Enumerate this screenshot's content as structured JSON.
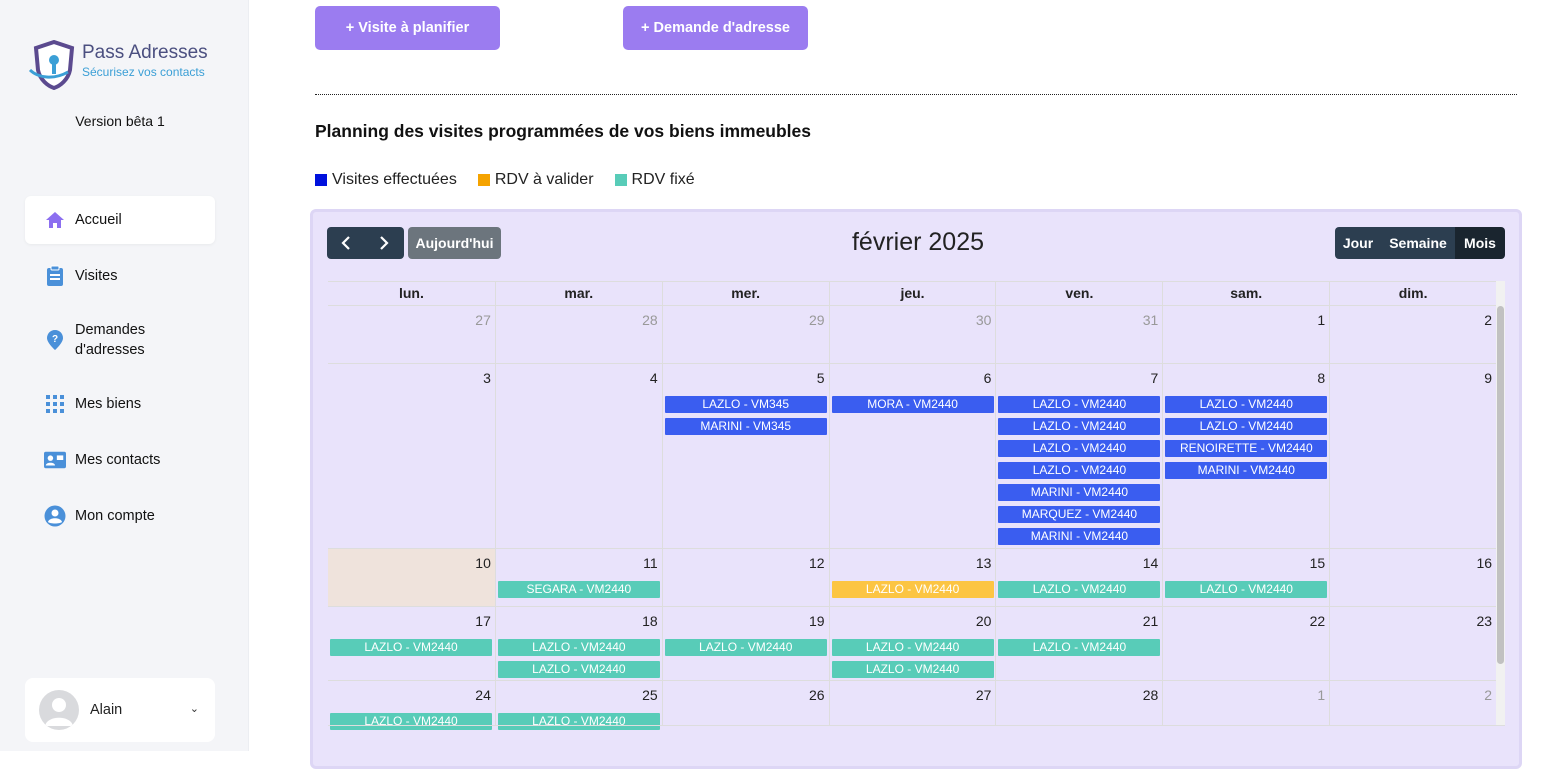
{
  "sidebar": {
    "logo_title": "Pass Adresses",
    "logo_tagline": "Sécurisez vos contacts",
    "version": "Version bêta 1",
    "items": [
      {
        "label": "Accueil",
        "icon": "home-icon"
      },
      {
        "label": "Visites",
        "icon": "clipboard-icon"
      },
      {
        "label": "Demandes d'adresses",
        "icon": "location-question-icon"
      },
      {
        "label": "Mes biens",
        "icon": "grid-icon"
      },
      {
        "label": "Mes contacts",
        "icon": "contact-card-icon"
      },
      {
        "label": "Mon compte",
        "icon": "user-circle-icon"
      }
    ],
    "user": {
      "name": "Alain"
    }
  },
  "main": {
    "btn_visite": "+ Visite à planifier",
    "btn_demande": "+ Demande d'adresse",
    "title": "Planning des visites programmées de vos biens immeubles",
    "legend": [
      {
        "label": "Visites effectuées",
        "color": "#0011dd"
      },
      {
        "label": "RDV à valider",
        "color": "#f5a300"
      },
      {
        "label": "RDV fixé",
        "color": "#58ccb8"
      }
    ]
  },
  "calendar": {
    "title": "février 2025",
    "today_label": "Aujourd'hui",
    "views": [
      "Jour",
      "Semaine",
      "Mois"
    ],
    "active_view": "Mois",
    "weekdays": [
      "lun.",
      "mar.",
      "mer.",
      "jeu.",
      "ven.",
      "sam.",
      "dim."
    ],
    "colors": {
      "done": "#3a5df0",
      "pending": "#fcc543",
      "fixed": "#58ccb8"
    },
    "weeks": [
      {
        "days": [
          {
            "n": "27",
            "other": true,
            "events": []
          },
          {
            "n": "28",
            "other": true,
            "events": []
          },
          {
            "n": "29",
            "other": true,
            "events": []
          },
          {
            "n": "30",
            "other": true,
            "events": []
          },
          {
            "n": "31",
            "other": true,
            "events": []
          },
          {
            "n": "1",
            "events": []
          },
          {
            "n": "2",
            "events": []
          }
        ]
      },
      {
        "days": [
          {
            "n": "3",
            "events": []
          },
          {
            "n": "4",
            "events": []
          },
          {
            "n": "5",
            "events": [
              {
                "t": "LAZLO - VM345",
                "s": "done"
              },
              {
                "t": "MARINI - VM345",
                "s": "done"
              }
            ]
          },
          {
            "n": "6",
            "events": [
              {
                "t": "MORA - VM2440",
                "s": "done"
              }
            ]
          },
          {
            "n": "7",
            "events": [
              {
                "t": "LAZLO - VM2440",
                "s": "done"
              },
              {
                "t": "LAZLO - VM2440",
                "s": "done"
              },
              {
                "t": "LAZLO - VM2440",
                "s": "done"
              },
              {
                "t": "LAZLO - VM2440",
                "s": "done"
              },
              {
                "t": "MARINI - VM2440",
                "s": "done"
              },
              {
                "t": "MARQUEZ - VM2440",
                "s": "done"
              },
              {
                "t": "MARINI - VM2440",
                "s": "done"
              }
            ]
          },
          {
            "n": "8",
            "events": [
              {
                "t": "LAZLO - VM2440",
                "s": "done"
              },
              {
                "t": "LAZLO - VM2440",
                "s": "done"
              },
              {
                "t": "RENOIRETTE - VM2440",
                "s": "done"
              },
              {
                "t": "MARINI - VM2440",
                "s": "done"
              }
            ]
          },
          {
            "n": "9",
            "events": []
          }
        ]
      },
      {
        "days": [
          {
            "n": "10",
            "today": true,
            "events": []
          },
          {
            "n": "11",
            "events": [
              {
                "t": "SEGARA - VM2440",
                "s": "fixed"
              }
            ]
          },
          {
            "n": "12",
            "events": []
          },
          {
            "n": "13",
            "events": [
              {
                "t": "LAZLO - VM2440",
                "s": "pending"
              }
            ]
          },
          {
            "n": "14",
            "events": [
              {
                "t": "LAZLO - VM2440",
                "s": "fixed"
              }
            ]
          },
          {
            "n": "15",
            "events": [
              {
                "t": "LAZLO - VM2440",
                "s": "fixed"
              }
            ]
          },
          {
            "n": "16",
            "events": []
          }
        ]
      },
      {
        "days": [
          {
            "n": "17",
            "events": [
              {
                "t": "LAZLO - VM2440",
                "s": "fixed"
              }
            ]
          },
          {
            "n": "18",
            "events": [
              {
                "t": "LAZLO - VM2440",
                "s": "fixed"
              },
              {
                "t": "LAZLO - VM2440",
                "s": "fixed"
              }
            ]
          },
          {
            "n": "19",
            "events": [
              {
                "t": "LAZLO - VM2440",
                "s": "fixed"
              }
            ]
          },
          {
            "n": "20",
            "events": [
              {
                "t": "LAZLO - VM2440",
                "s": "fixed"
              },
              {
                "t": "LAZLO - VM2440",
                "s": "fixed"
              }
            ]
          },
          {
            "n": "21",
            "events": [
              {
                "t": "LAZLO - VM2440",
                "s": "fixed"
              }
            ]
          },
          {
            "n": "22",
            "events": []
          },
          {
            "n": "23",
            "events": []
          }
        ]
      },
      {
        "days": [
          {
            "n": "24",
            "events": [
              {
                "t": "LAZLO - VM2440",
                "s": "fixed"
              }
            ]
          },
          {
            "n": "25",
            "events": [
              {
                "t": "LAZLO - VM2440",
                "s": "fixed"
              }
            ]
          },
          {
            "n": "26",
            "events": []
          },
          {
            "n": "27",
            "events": []
          },
          {
            "n": "28",
            "events": []
          },
          {
            "n": "1",
            "other": true,
            "events": []
          },
          {
            "n": "2",
            "other": true,
            "events": []
          }
        ]
      }
    ]
  }
}
